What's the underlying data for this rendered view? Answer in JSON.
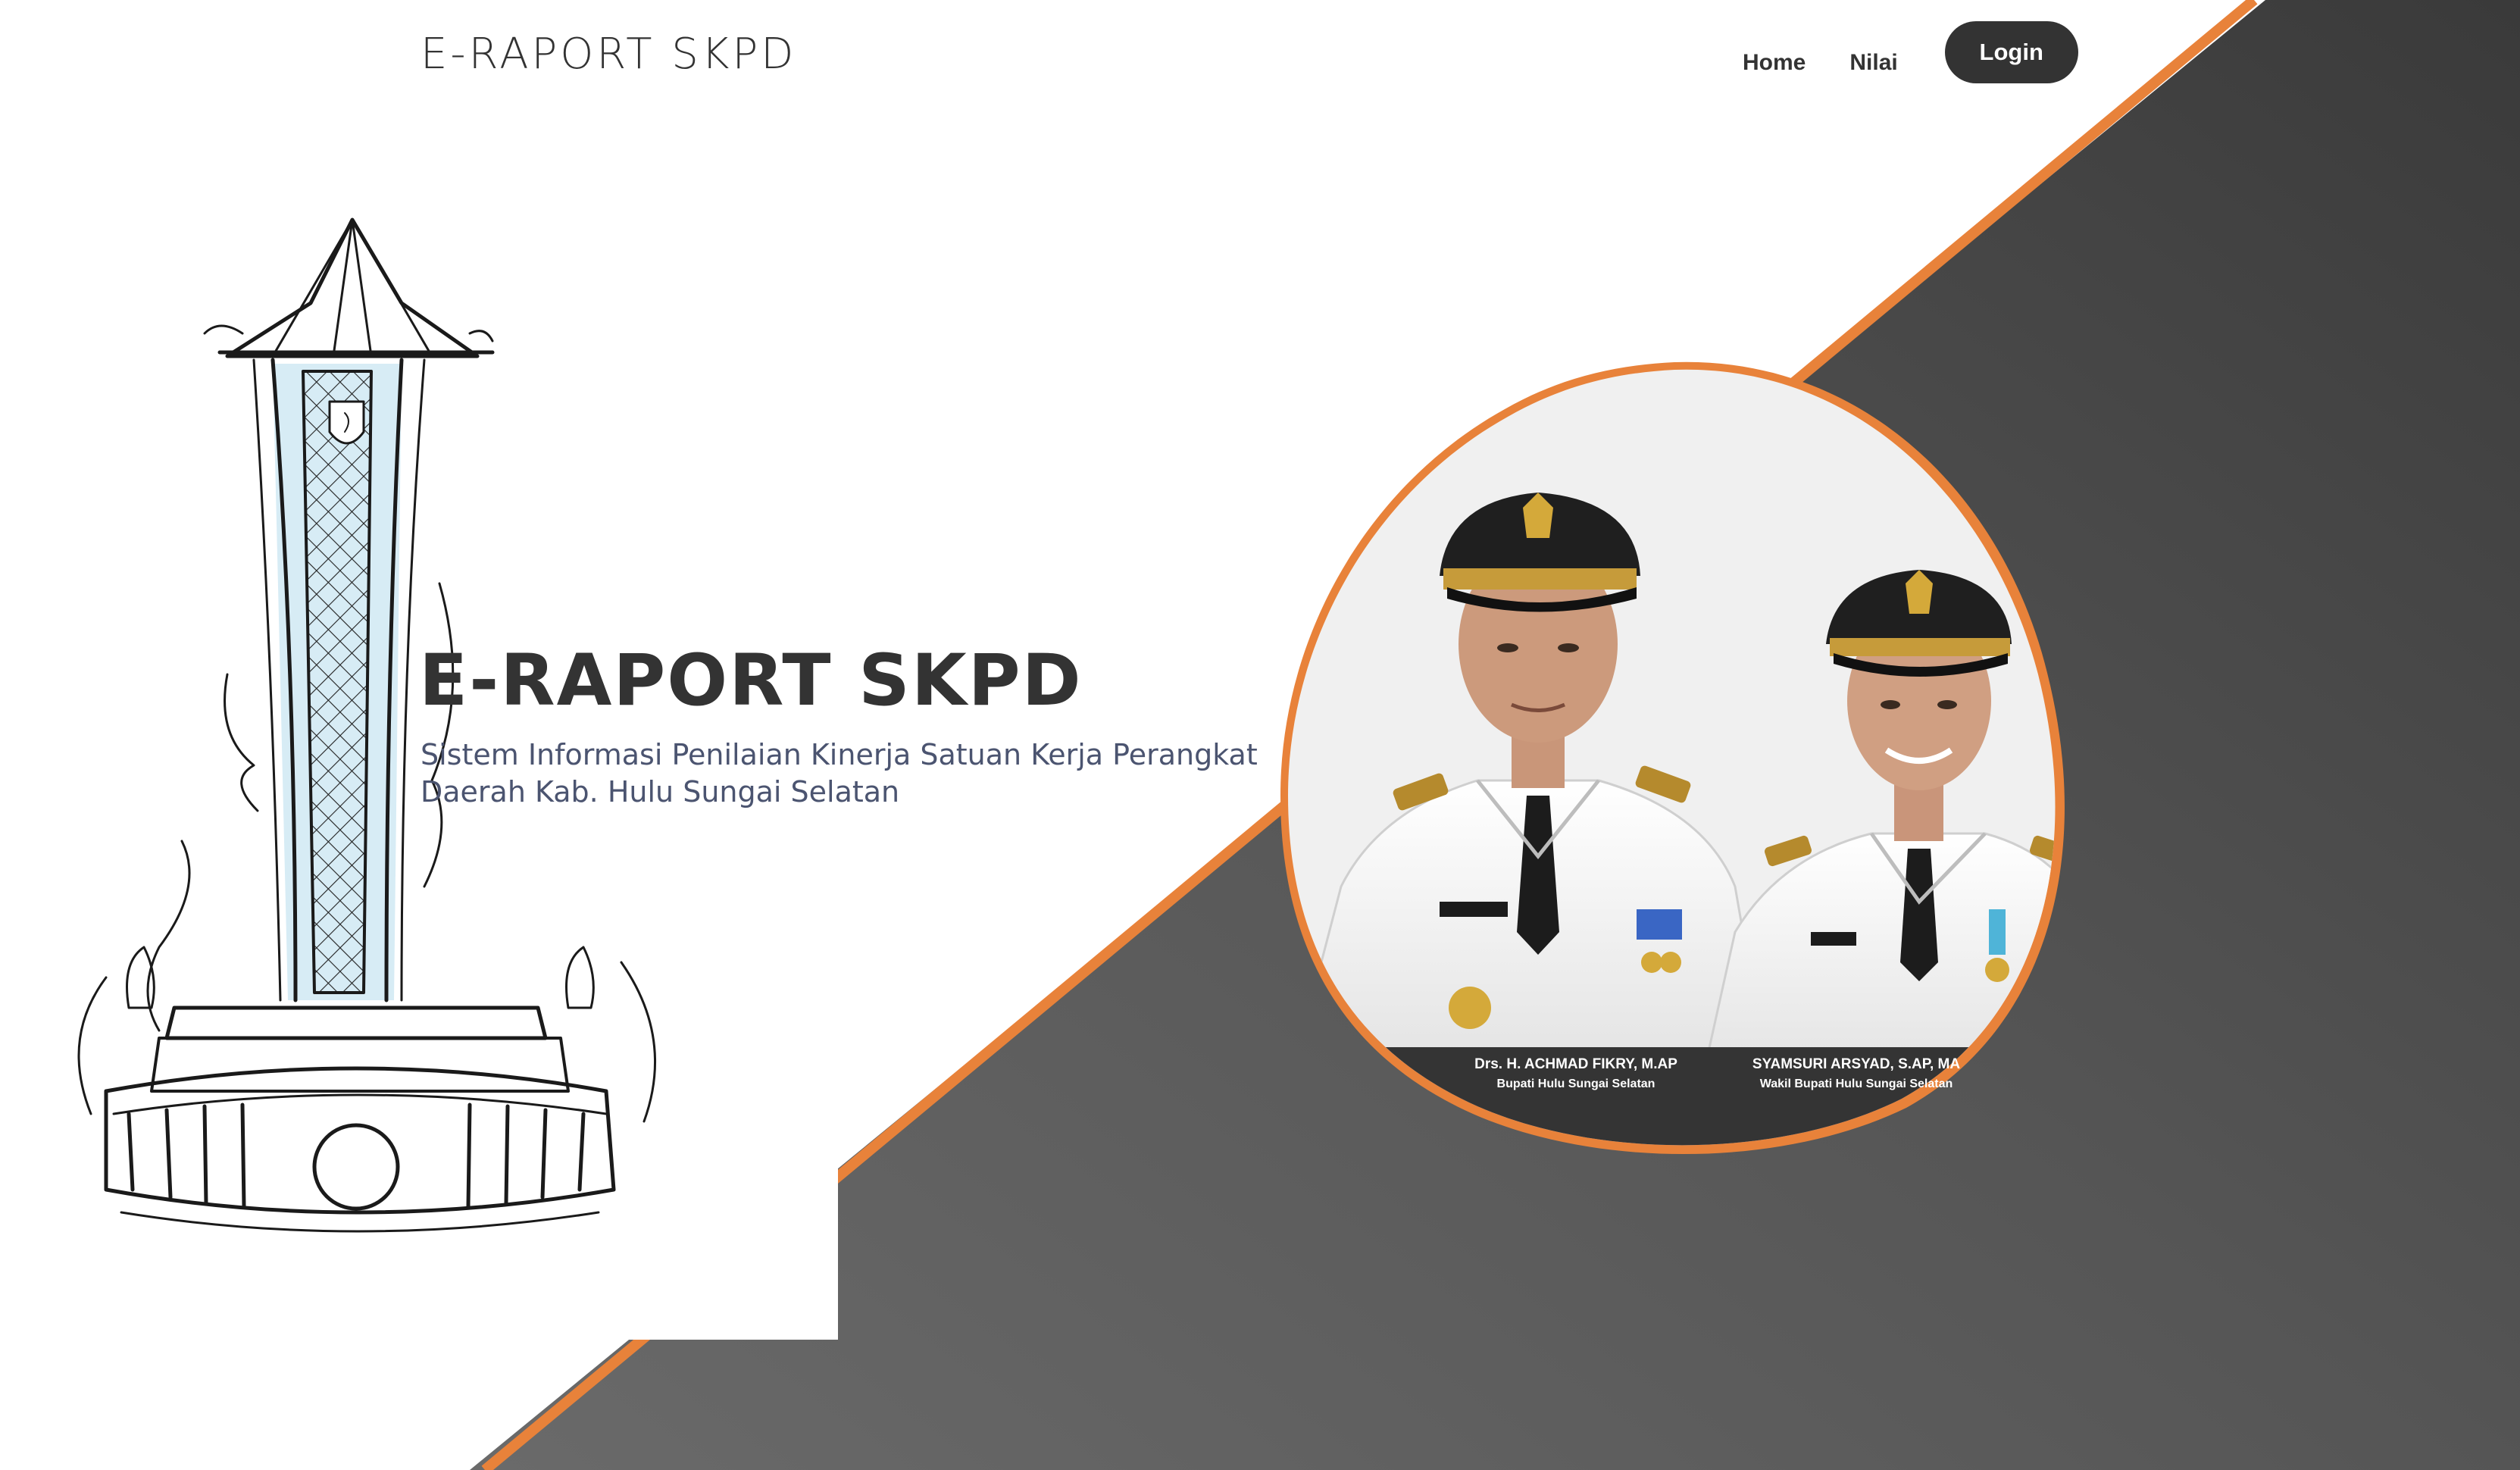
{
  "header": {
    "brand": "E-RAPORT SKPD",
    "nav": {
      "home_label": "Home",
      "nilai_label": "Nilai",
      "login_label": "Login"
    }
  },
  "hero": {
    "title": "E-RAPORT SKPD",
    "subtitle_line1": "Sistem Informasi Penilaian Kinerja Satuan Kerja Perangkat",
    "subtitle_line2": "Daerah Kab. Hulu Sungai Selatan"
  },
  "officials": [
    {
      "name": "Drs. H. ACHMAD FIKRY, M.AP",
      "role": "Bupati Hulu Sungai Selatan"
    },
    {
      "name": "SYAMSURI ARSYAD, S.AP, MA",
      "role": "Wakil Bupati Hulu Sungai Selatan"
    }
  ],
  "colors": {
    "accent_orange": "#e8823a",
    "dark_gray": "#333333",
    "band_gray": "#555555",
    "subtitle_text": "#4b5470"
  },
  "icons": {
    "monument": "monument-sketch-illustration",
    "officials_photo": "officials-portrait-photo"
  }
}
